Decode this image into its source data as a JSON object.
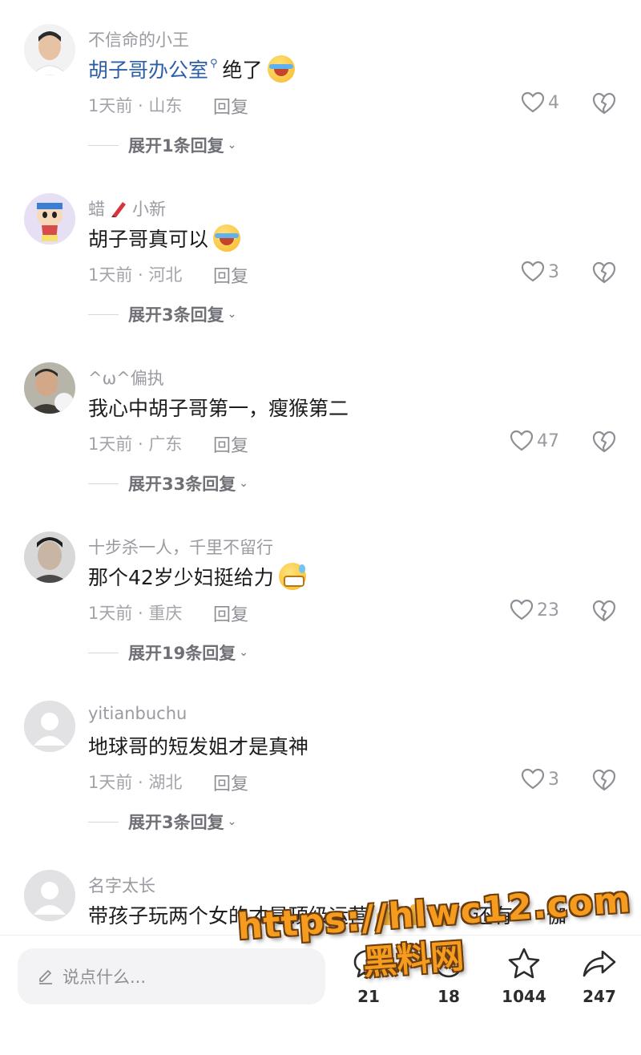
{
  "comments": [
    {
      "username": "不信命的小王",
      "content_link": "胡子哥办公室",
      "content_text": "绝了",
      "emoji": "tears-of-joy-emoji",
      "meta": "1天前 · 山东",
      "reply": "回复",
      "likes": "4",
      "expand": "展开1条回复"
    },
    {
      "username": "蜡",
      "username_suffix": "小新",
      "content_text": "胡子哥真可以",
      "emoji": "crying-laughing-emoji",
      "meta": "1天前 · 河北",
      "reply": "回复",
      "likes": "3",
      "expand": "展开3条回复"
    },
    {
      "username": "^ω^偏执",
      "content_text": "我心中胡子哥第一，瘦猴第二",
      "meta": "1天前 · 广东",
      "reply": "回复",
      "likes": "47",
      "expand": "展开33条回复"
    },
    {
      "username": "十步杀一人，千里不留行",
      "content_text": "那个42岁少妇挺给力",
      "emoji": "grinning-sweat-emoji",
      "meta": "1天前 · 重庆",
      "reply": "回复",
      "likes": "23",
      "expand": "展开19条回复"
    },
    {
      "username": "yitianbuchu",
      "content_text": "地球哥的短发姐才是真神",
      "meta": "1天前 · 湖北",
      "reply": "回复",
      "likes": "3",
      "expand": "展开3条回复"
    },
    {
      "username": "名字太长",
      "content_text": "带孩子玩两个女的才是顶级运营",
      "content_tail": "还有",
      "content_end": "伽",
      "emoji": "thumbs-up-emoji"
    }
  ],
  "bottom_bar": {
    "input_placeholder": "说点什么...",
    "comment_count": "21",
    "share_count_partial": "18",
    "favorite_count": "1044",
    "share_count": "247"
  },
  "watermark": {
    "url": "https://hlwc12.com",
    "name": "黑料网"
  },
  "colors": {
    "link": "#2d5fa8",
    "secondary_text": "#9a9ba1",
    "watermark": "#f59b1e"
  }
}
